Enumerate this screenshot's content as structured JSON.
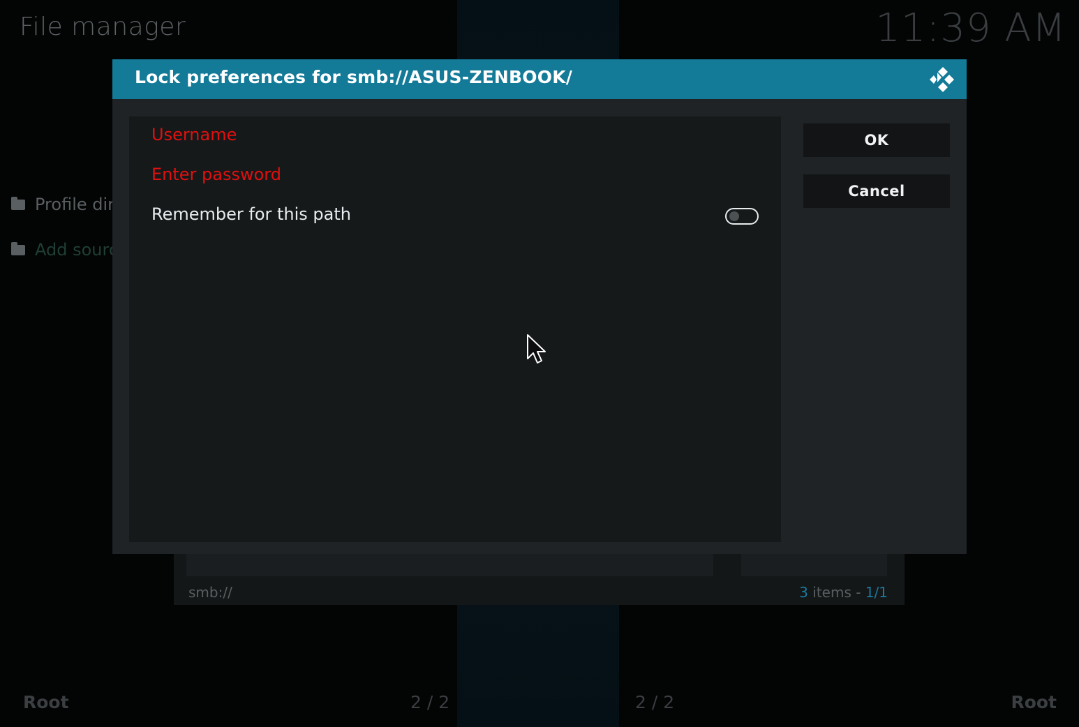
{
  "window": {
    "title": "File manager",
    "clock": "11:39 AM"
  },
  "background": {
    "items": [
      {
        "label": "Profile dir",
        "icon": "folder-icon"
      },
      {
        "label": "Add sourc",
        "icon": "folder-icon"
      }
    ],
    "path": "smb://",
    "count_number": "3",
    "count_text": " items - ",
    "count_page": "1/1",
    "footer": {
      "left": "Root",
      "center_left": "2 / 2",
      "center_right": "2 / 2",
      "right": "Root"
    }
  },
  "dialog": {
    "title": "Lock preferences for smb://ASUS-ZENBOOK/",
    "logo_icon": "kodi-logo-icon",
    "settings": [
      {
        "label": "Username",
        "state": "error"
      },
      {
        "label": "Enter password",
        "state": "error"
      },
      {
        "label": "Remember for this path",
        "state": "normal",
        "toggle": "off"
      }
    ],
    "buttons": {
      "ok": "OK",
      "cancel": "Cancel"
    }
  },
  "colors": {
    "header": "#137a98",
    "error_text": "#e0100f",
    "accent": "#1b7aa0"
  }
}
